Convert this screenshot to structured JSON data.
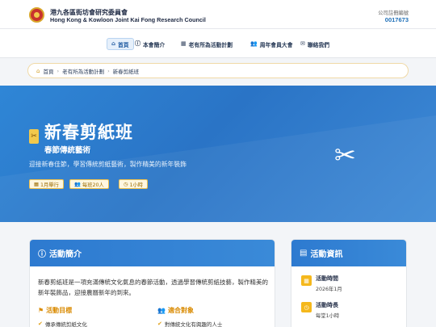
{
  "header": {
    "org_name_zh": "港九各區街坊會研究委員會",
    "org_name_en": "Hong Kong & Kowloon Joint Kai Fong Research Council",
    "reg_label": "公司註冊編號",
    "reg_number": "0017673"
  },
  "nav": {
    "items": [
      {
        "icon": "⌂",
        "label": "首頁"
      },
      {
        "icon": "ⓘ",
        "label": "本會簡介"
      },
      {
        "icon": "▦",
        "label": "老有所為活動計劃"
      },
      {
        "icon": "👥",
        "label": "周年會員大會"
      },
      {
        "icon": "✉",
        "label": "聯絡我們"
      }
    ]
  },
  "breadcrumb": {
    "home": "首頁",
    "parent": "老有所為活動計劃",
    "current": "新春剪紙班",
    "sep": "›"
  },
  "hero": {
    "badge_icon": "✂",
    "title": "新春剪紙班",
    "subtitle": "春節傳統藝術",
    "description": "迎接新春佳節，學習傳統剪紙藝術，製作精美的新年裝飾",
    "tags": [
      {
        "icon": "▦",
        "text": "1月舉行"
      },
      {
        "icon": "👥",
        "text": "每班20人"
      },
      {
        "icon": "◷",
        "text": "1小時"
      }
    ],
    "scissors_icon": "✂"
  },
  "main_card": {
    "icon": "ⓘ",
    "title": "活動簡介",
    "intro": "新春剪紙班是一項充滿傳統文化氣息的春節活動，透過學習傳統剪紙技藝，製作精美的新年裝飾品，迎接農曆新年的到來。",
    "goals_title": "活動目標",
    "goals_first": "傳承傳統剪紙文化",
    "audience_title": "適合對象",
    "audience_first": "對傳統文化有興趣的人士"
  },
  "side_card": {
    "title": "活動資訊",
    "items": [
      {
        "icon": "▦",
        "label": "活動時間",
        "value": "2026年1月"
      },
      {
        "icon": "◷",
        "label": "活動時長",
        "value": "每堂1小時"
      }
    ]
  },
  "colors": {
    "primary_blue": "#2d7ad0",
    "accent_gold": "#f2c94c",
    "brand_red": "#c8322e"
  }
}
